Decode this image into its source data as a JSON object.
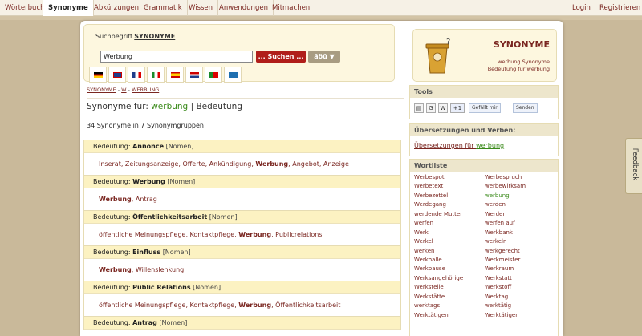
{
  "nav": {
    "items": [
      "Wörterbuch",
      "Synonyme",
      "Abkürzungen",
      "Grammatik",
      "Wissen",
      "Anwendungen",
      "Mitmachen"
    ],
    "login": "Login",
    "register": "Registrieren"
  },
  "search": {
    "label_prefix": "Suchbegriff",
    "label_strong": "SYNONYME",
    "value": "Werbung",
    "button": "... Suchen ...",
    "special_chars": "äöü ▼"
  },
  "breadcrumb": [
    "SYNONYME",
    "W",
    "WERBUNG"
  ],
  "heading": {
    "prefix": "Synonyme für:",
    "term": "werbung",
    "sep": "|",
    "suffix": "Bedeutung"
  },
  "count": "34 Synonyme in 7 Synonymgruppen",
  "groups": [
    {
      "label": "Bedeutung:",
      "meaning": "Annonce",
      "type": "[Nomen]",
      "syn_a": "Inserat, Zeitungsanzeige, Offerte, Ankündigung, ",
      "syn_b": "Werbung",
      "syn_c": ", Angebot, Anzeige"
    },
    {
      "label": "Bedeutung:",
      "meaning": "Werbung",
      "type": "[Nomen]",
      "syn_a": "",
      "syn_b": "Werbung",
      "syn_c": ", Antrag"
    },
    {
      "label": "Bedeutung:",
      "meaning": "Öffentlichkeitsarbeit",
      "type": "[Nomen]",
      "syn_a": "öffentliche Meinungspflege, Kontaktpflege, ",
      "syn_b": "Werbung",
      "syn_c": ", Publicrelations"
    },
    {
      "label": "Bedeutung:",
      "meaning": "Einfluss",
      "type": "[Nomen]",
      "syn_a": "",
      "syn_b": "Werbung",
      "syn_c": ", Willenslenkung"
    },
    {
      "label": "Bedeutung:",
      "meaning": "Public Relations",
      "type": "[Nomen]",
      "syn_a": "öffentliche Meinungspflege, Kontaktpflege, ",
      "syn_b": "Werbung",
      "syn_c": ", Öffentlichkeitsarbeit"
    },
    {
      "label": "Bedeutung:",
      "meaning": "Antrag",
      "type": "[Nomen]",
      "syn_a": "",
      "syn_b": "",
      "syn_c": ""
    }
  ],
  "logo": {
    "title": "SYNONYME",
    "line1": "werbung Synonyme",
    "line2": "Bedeutung für werbung"
  },
  "tools": {
    "title": "Tools",
    "like": "Gefällt mir",
    "send": "Senden",
    "icons": [
      "print-icon",
      "google-icon",
      "wikipedia-icon",
      "google-plus-icon",
      "facebook-like-icon",
      "send-icon"
    ]
  },
  "translations": {
    "title": "Übersetzungen und Verben:",
    "link_prefix": "Übersetzungen für ",
    "link_term": "werbung"
  },
  "wordlist": {
    "title": "Wortliste",
    "left": [
      "Werbespot",
      "Werbetext",
      "Werbezettel",
      "Werdegang",
      "werdende Mutter",
      "werfen",
      "Werk",
      "Werkel",
      "werken",
      "Werkhalle",
      "Werkpause",
      "Werksangehörige",
      "Werkstelle",
      "Werkstätte",
      "werktags",
      "Werktätigen"
    ],
    "right": [
      "Werbespruch",
      "werbewirksam",
      "werbung",
      "werden",
      "Werder",
      "werfen auf",
      "Werkbank",
      "werkeln",
      "werkgerecht",
      "Werkmeister",
      "Werkraum",
      "Werkstatt",
      "Werkstoff",
      "Werktag",
      "werktätig",
      "Werktätiger"
    ],
    "current": "werbung"
  },
  "feedback": "Feedback",
  "colors": {
    "accent": "#7a2620",
    "button": "#b01e1a",
    "highlight": "#3a8a1a",
    "panel": "#fcf2c2"
  }
}
